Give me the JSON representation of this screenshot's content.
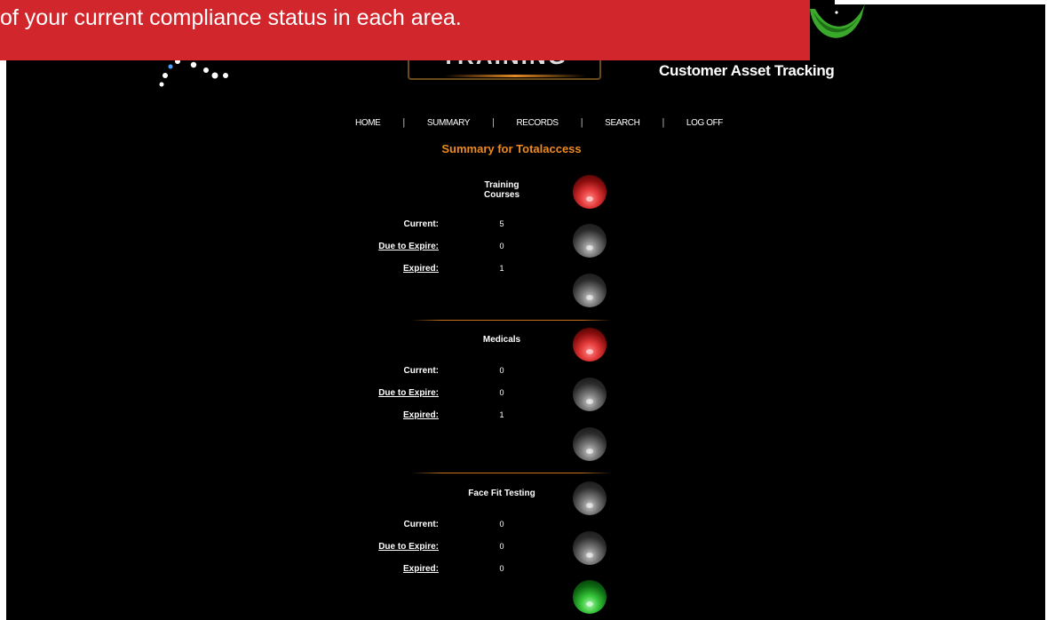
{
  "banner": {
    "text": "of your current compliance status in each area."
  },
  "brand": {
    "training_logo_text": "TRAINING",
    "cat_text": "Customer Asset Tracking"
  },
  "nav": {
    "items": [
      "HOME",
      "SUMMARY",
      "RECORDS",
      "SEARCH",
      "LOG OFF"
    ]
  },
  "summary_title": "Summary for Totalaccess",
  "labels": {
    "current": "Current:",
    "due": "Due to Expire",
    "due_colon": ":",
    "due_full": "Due to Expire:",
    "expired": "Expired",
    "expired_colon": ":",
    "expired_full": "Expired:"
  },
  "sections": [
    {
      "title": "Training Courses",
      "current": "5",
      "due": "0",
      "expired": "1",
      "lights": [
        "red",
        "grey",
        "grey"
      ]
    },
    {
      "title": "Medicals",
      "current": "0",
      "due": "0",
      "expired": "1",
      "lights": [
        "red",
        "grey",
        "grey"
      ]
    },
    {
      "title": "Face Fit Testing",
      "current": "0",
      "due": "0",
      "expired": "0",
      "lights": [
        "grey",
        "grey",
        "green"
      ]
    }
  ],
  "colors": {
    "accent": "#ee8a1f",
    "banner": "#d1262b",
    "background": "#000000"
  }
}
